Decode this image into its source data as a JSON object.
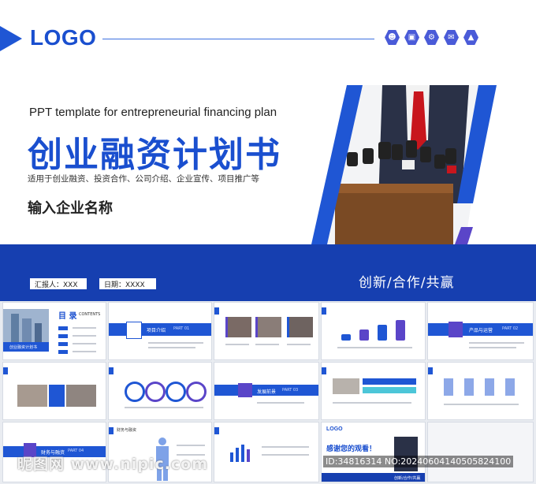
{
  "header": {
    "logo": "LOGO",
    "icons": [
      "people-icon",
      "image-icon",
      "gear-icon",
      "mail-icon",
      "chart-icon"
    ]
  },
  "hero": {
    "english_title": "PPT template for entrepreneurial financing plan",
    "chinese_title": "创业融资计划书",
    "subtitle": "适用于创业融资、投资合作、公司介绍、企业宣传、项目推广等",
    "company_placeholder": "输入企业名称",
    "reporter": "汇报人：XXX",
    "date": "日期：XXXX",
    "slogan": "创新/合作/共赢"
  },
  "thumbnails": {
    "toc_title": "目 录",
    "toc_sub": "CONTENTS",
    "cover_mini": "创业融资计划书",
    "part1": "项目介绍",
    "part1_no": "PART 01",
    "part2": "产品与运营",
    "part2_no": "PART 02",
    "part3": "发展前景",
    "part3_no": "PART 03",
    "part4": "财务与融资",
    "part4_no": "PART 04",
    "finance_head": "财务与融资",
    "end_logo": "LOGO",
    "thanks": "感谢您的观看！",
    "end_slogan": "创新/合作/共赢"
  },
  "watermark": {
    "site": "昵图网 www.nipic.com",
    "id_line": "ID:34816314 NO:20240604140505824100"
  },
  "colors": {
    "brand_blue": "#1a4fcf",
    "dark_band": "#163fb0",
    "accent_purple": "#5a45c8"
  }
}
